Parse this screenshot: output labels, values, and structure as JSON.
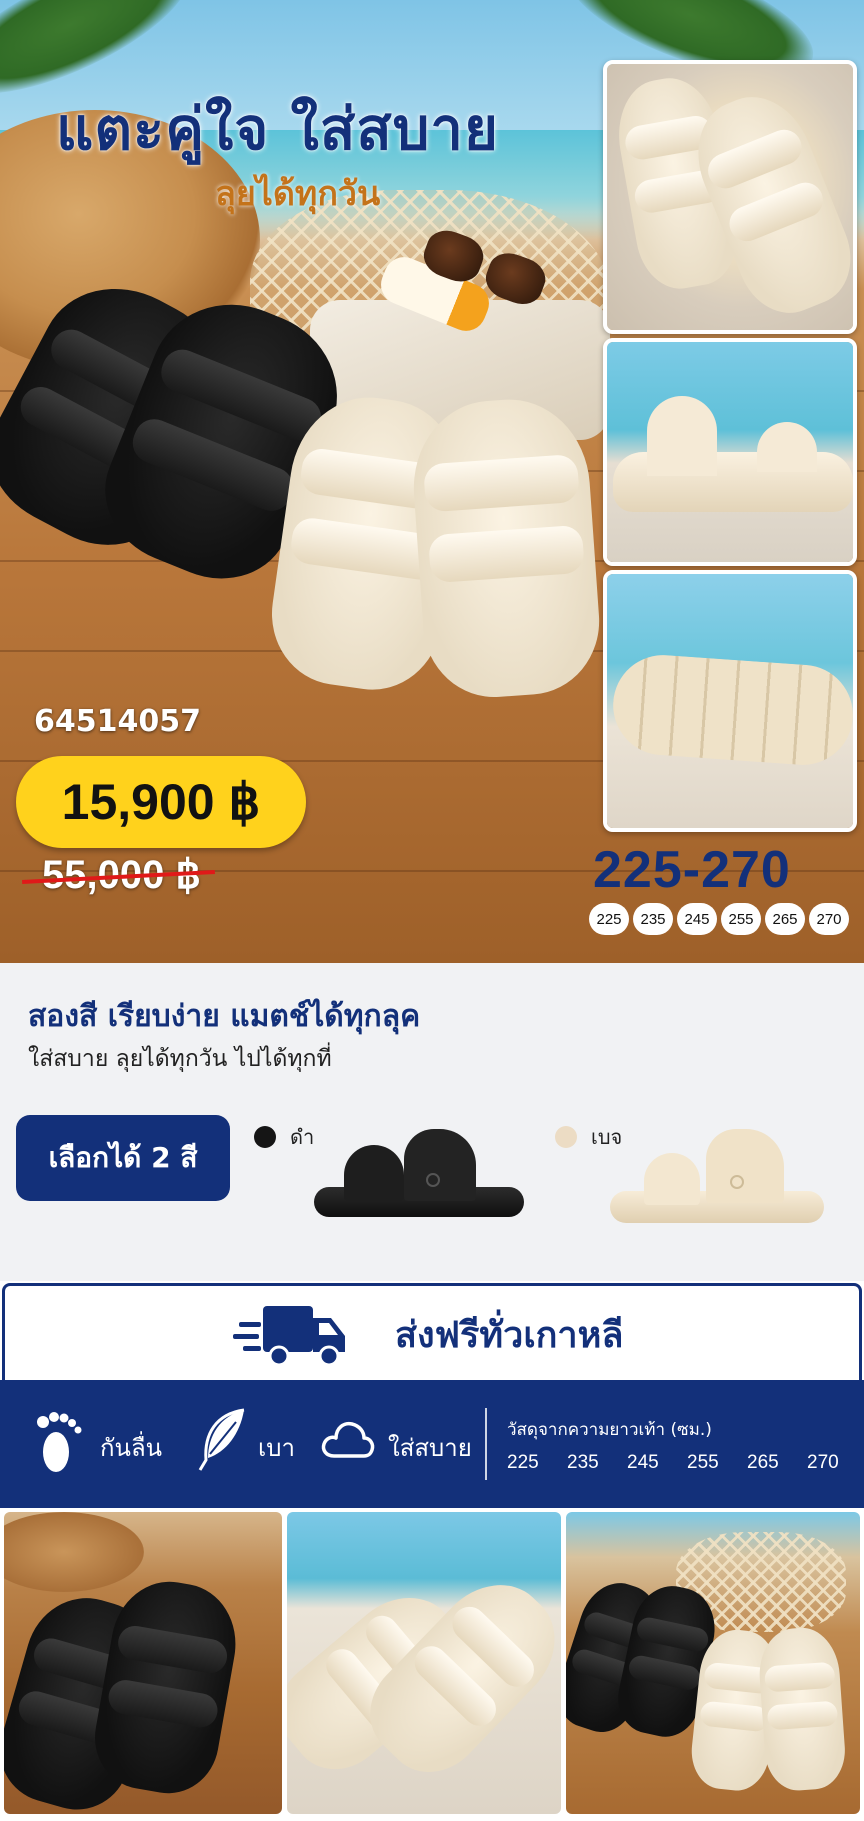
{
  "hero": {
    "title": "แตะคู่ใจ ใส่สบาย",
    "subtitle": "ลุยได้ทุกวัน",
    "sku": "64514057",
    "price": "15,900 ฿",
    "old_price": "55,000 ฿",
    "size_range": "225-270",
    "sizes": [
      "225",
      "235",
      "245",
      "255",
      "265",
      "270"
    ]
  },
  "colors_section": {
    "title": "สองสี เรียบง่าย แมตช์ได้ทุกลุค",
    "subtitle": "ใส่สบาย ลุยได้ทุกวัน ไปได้ทุกที่",
    "choose_label": "เลือกได้ 2 สี",
    "options": [
      {
        "label": "ดำ",
        "color": "#151515"
      },
      {
        "label": "เบจ",
        "color": "#ecdcc4"
      }
    ]
  },
  "shipping": {
    "text": "ส่งฟรีทั่วเกาหลี",
    "icon": "delivery-truck-icon"
  },
  "features": {
    "items": [
      {
        "label": "กันลื่น",
        "icon": "footprint-icon"
      },
      {
        "label": "เบา",
        "icon": "feather-icon"
      },
      {
        "label": "ใส่สบาย",
        "icon": "cloud-icon"
      }
    ],
    "measure_title": "วัสดุจากความยาวเท้า (ซม.)",
    "measure_sizes": [
      "225",
      "235",
      "245",
      "255",
      "265",
      "270"
    ]
  },
  "theme": {
    "primary": "#13307a",
    "accent": "#ffd21c",
    "strike": "#e01919"
  }
}
